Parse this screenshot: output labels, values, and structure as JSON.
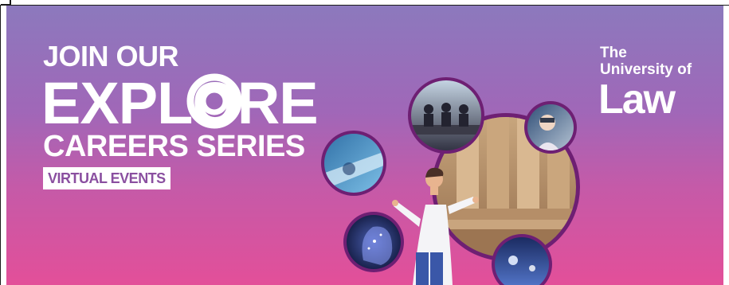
{
  "banner": {
    "headline_line1": "JOIN OUR",
    "headline_line2": "EXPLORE",
    "headline_line3": "CAREERS SERIES",
    "badge": "VIRTUAL EVENTS",
    "logo": {
      "line1": "The",
      "line2": "University of",
      "line3": "Law"
    },
    "colors": {
      "gradient_top": "#8c79bd",
      "gradient_bottom": "#e34f99",
      "ring": "#6e1f73",
      "text": "#ffffff"
    }
  }
}
